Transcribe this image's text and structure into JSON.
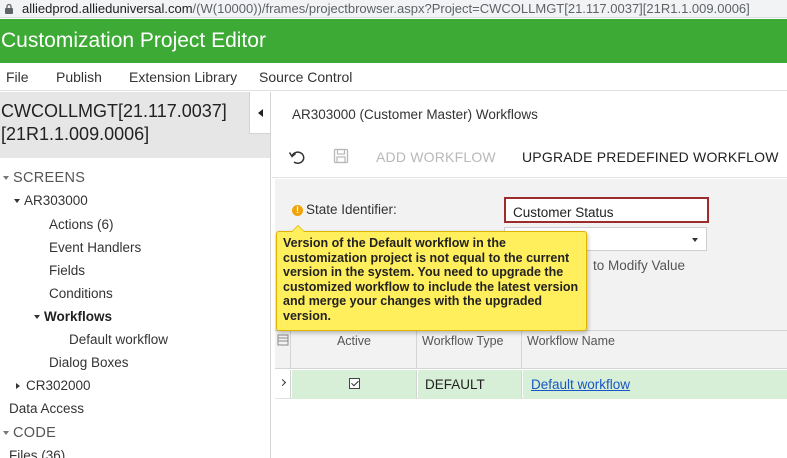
{
  "browser": {
    "url_host": "alliedprod.allieduniversal.com",
    "url_path": "/(W(10000))/frames/projectbrowser.aspx?Project=CWCOLLMGT[21.117.0037][21R1.1.009.0006]"
  },
  "app": {
    "title": "Customization Project Editor"
  },
  "menu": [
    "File",
    "Publish",
    "Extension Library",
    "Source Control"
  ],
  "project": {
    "line1": "CWCOLLMGT[21.117.0037]",
    "line2": "[21R1.1.009.0006]"
  },
  "tree": {
    "screens_label": "SCREENS",
    "ar_screen": "AR303000",
    "actions": "Actions (6)",
    "event_handlers": "Event Handlers",
    "fields": "Fields",
    "conditions": "Conditions",
    "workflows": "Workflows",
    "default_workflow": "Default workflow",
    "dialog_boxes": "Dialog Boxes",
    "cr_screen": "CR302000",
    "data_access": "Data Access",
    "code_label": "CODE",
    "files": "Files (36)"
  },
  "main": {
    "title": "AR303000 (Customer Master) Workflows",
    "add_workflow": "ADD WORKFLOW",
    "upgrade_workflow": "UPGRADE PREDEFINED WORKFLOW",
    "state_label": "State Identifier:",
    "state_value": "Customer Status",
    "modify_text": "to Modify Value"
  },
  "tooltip": {
    "text": "Version of the Default workflow in the customization project is not equal to the current version in the system. You need to upgrade the customized workflow to include the latest version and merge your changes with the upgraded version."
  },
  "grid": {
    "headers": {
      "active": "Active",
      "type": "Workflow Type",
      "name": "Workflow Name"
    },
    "rows": [
      {
        "active": true,
        "type": "DEFAULT",
        "name": "Default workflow"
      }
    ]
  },
  "colors": {
    "app_bar": "#3daa35",
    "tooltip_bg": "#ffef5c",
    "error_border": "#9c2b2b",
    "link": "#1a55c4",
    "row_highlight": "#d6efd6"
  }
}
